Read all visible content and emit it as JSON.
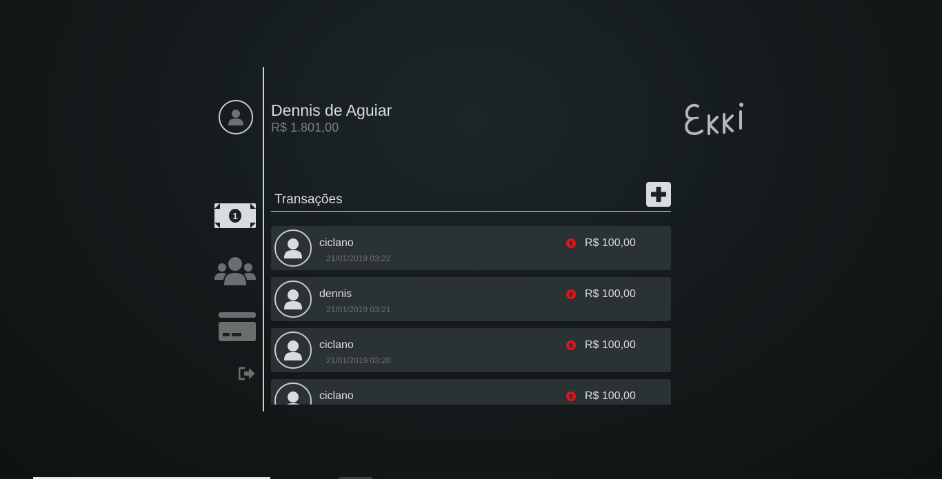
{
  "user": {
    "name": "Dennis de Aguiar",
    "balance": "R$ 1.801,00",
    "avatar_icon": "user-icon"
  },
  "logo": {
    "text": "Ekki"
  },
  "sidebar": {
    "items": [
      {
        "name": "money",
        "icon": "money-bill-icon"
      },
      {
        "name": "contacts",
        "icon": "users-icon"
      },
      {
        "name": "cards",
        "icon": "credit-card-icon"
      },
      {
        "name": "logout",
        "icon": "sign-out-icon"
      }
    ]
  },
  "transactions": {
    "title": "Transações",
    "add_icon": "plus-icon",
    "items": [
      {
        "name": "ciclano",
        "date": "21/01/2019 03:22",
        "amount": "R$ 100,00",
        "direction_icon": "arrow-up-circle-icon"
      },
      {
        "name": "dennis",
        "date": "21/01/2019 03:21",
        "amount": "R$ 100,00",
        "direction_icon": "arrow-up-circle-icon"
      },
      {
        "name": "ciclano",
        "date": "21/01/2019 03:20",
        "amount": "R$ 100,00",
        "direction_icon": "arrow-up-circle-icon"
      },
      {
        "name": "ciclano",
        "date": "",
        "amount": "R$ 100,00",
        "direction_icon": "arrow-up-circle-icon"
      }
    ]
  },
  "colors": {
    "background": "#151b1c",
    "card": "#2b3233",
    "outgoing": "#e0141b",
    "icon_gray": "#6b6e6f"
  }
}
